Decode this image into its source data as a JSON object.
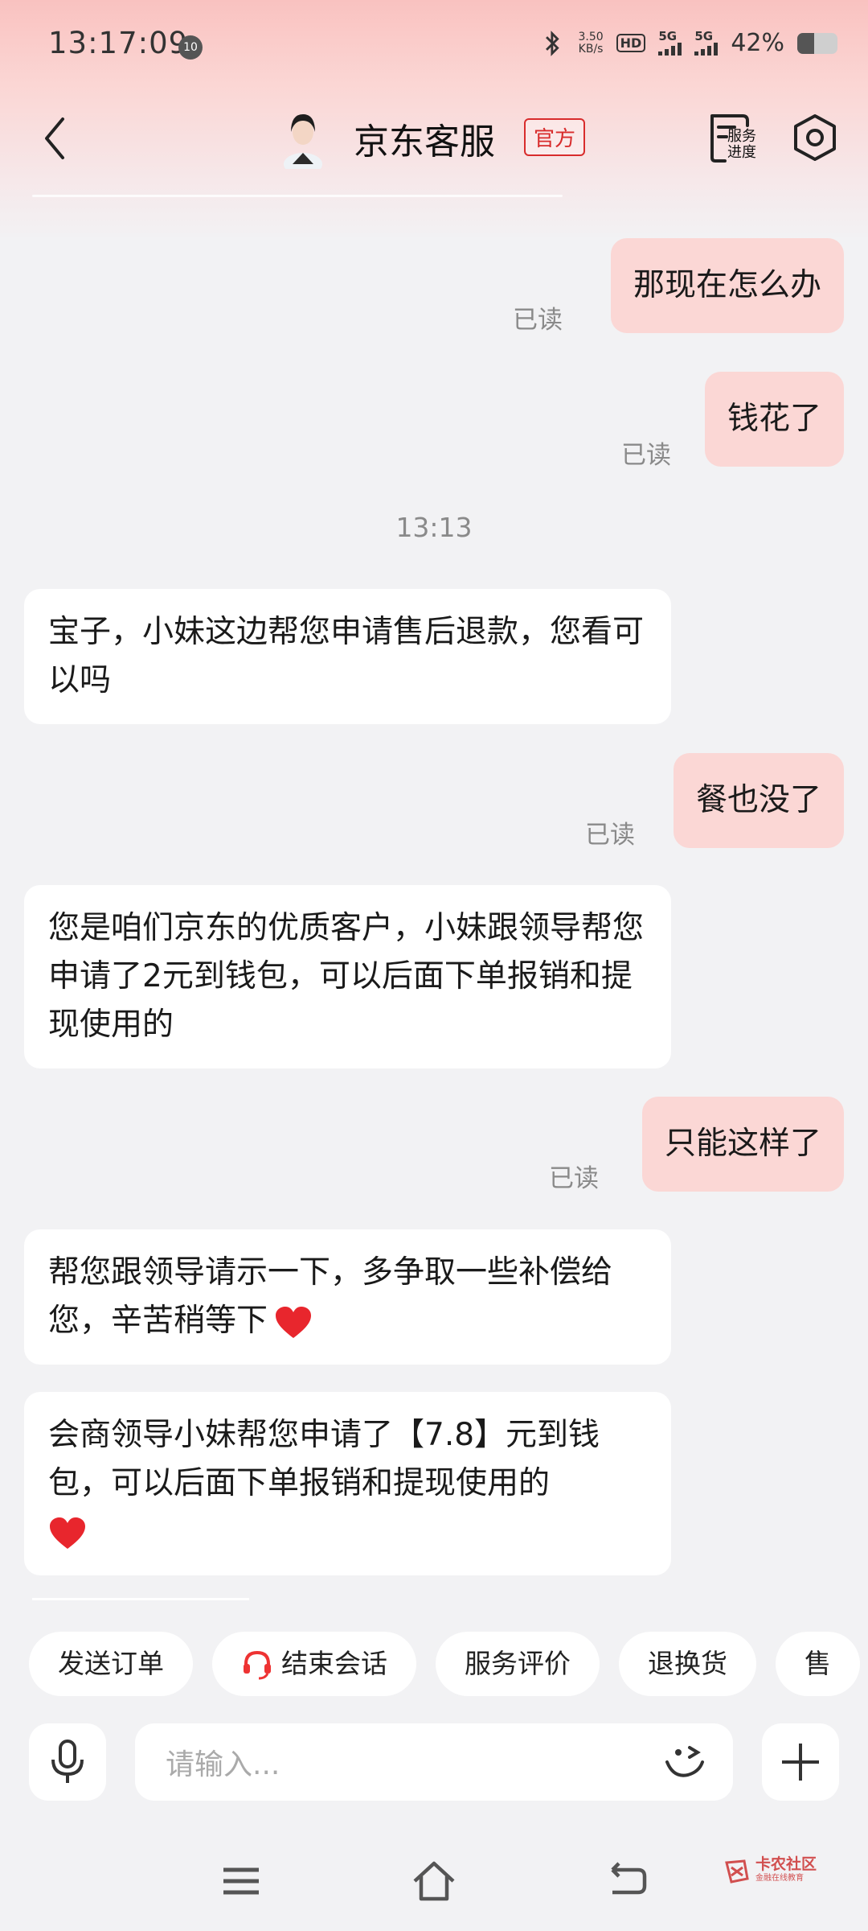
{
  "status_bar": {
    "time": "13:17:09",
    "notification_count": "10",
    "net_speed_value": "3.50",
    "net_speed_unit": "KB/s",
    "hd_label": "HD",
    "sim1_label": "5G",
    "sim2_label": "5G",
    "battery_percent": "42%",
    "battery_level": 0.42
  },
  "header": {
    "title": "京东客服",
    "badge": "官方",
    "progress_label": "服务进度"
  },
  "chat": {
    "messages": [
      {
        "text": "那现在怎么办",
        "read": "已读"
      },
      {
        "text": "钱花了",
        "read": "已读"
      },
      {
        "text": "宝子，小妹这边帮您申请售后退款，您看可以吗"
      },
      {
        "text": "餐也没了",
        "read": "已读"
      },
      {
        "text": "您是咱们京东的优质客户，小妹跟领导帮您申请了2元到钱包，可以后面下单报销和提现使用的"
      },
      {
        "text": "只能这样了",
        "read": "已读"
      },
      {
        "text": "帮您跟领导请示一下，多争取一些补偿给您，辛苦稍等下"
      },
      {
        "text": "会商领导小妹帮您申请了【7.8】元到钱包，可以后面下单报销和提现使用的"
      }
    ],
    "timestamp": "13:13"
  },
  "quick_actions": [
    "发送订单",
    "结束会话",
    "服务评价",
    "退换货",
    "售"
  ],
  "input": {
    "placeholder": "请输入..."
  },
  "watermark": {
    "main": "卡农社区",
    "sub": "金融在线教育"
  },
  "colors": {
    "accent": "#d82c2c",
    "outgoing_bubble": "#fbd7d5",
    "incoming_bubble": "#ffffff"
  }
}
